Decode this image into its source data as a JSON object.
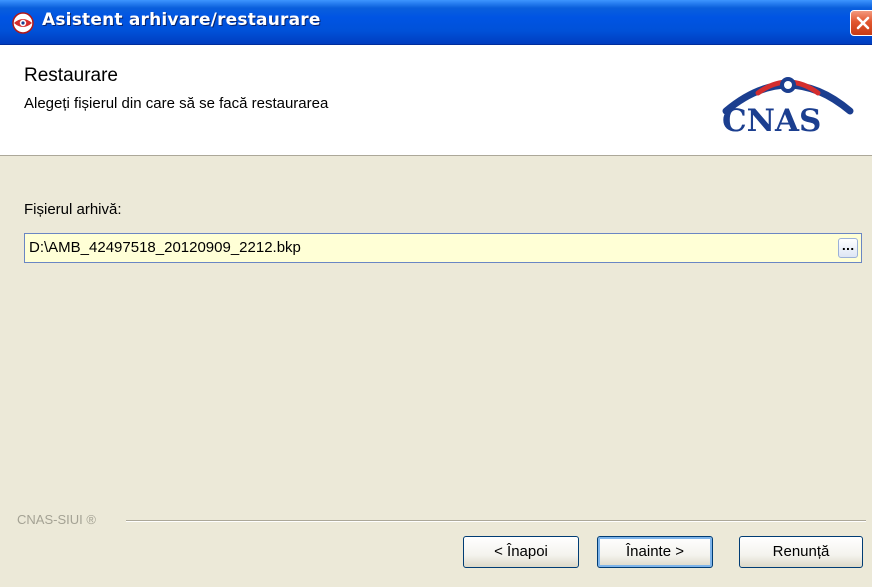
{
  "window": {
    "title": "Asistent arhivare/restaurare"
  },
  "header": {
    "title": "Restaurare",
    "subtitle": "Alegeți fișierul din care să se facă restaurarea",
    "logo_text": "CNAS"
  },
  "form": {
    "file_label": "Fișierul arhivă:",
    "file_value": "D:\\AMB_42497518_20120909_2212.bkp",
    "browse_label": "..."
  },
  "footer": {
    "brand": "CNAS-SIUI ®",
    "back_label": "< Înapoi",
    "next_label": "Înainte >",
    "cancel_label": "Renunță"
  },
  "colors": {
    "titlebar": "#0054e3",
    "dialog_bg": "#ece9d8",
    "field_bg": "#ffffd6",
    "logo_blue": "#1b3e8f",
    "logo_red": "#d42d2d"
  },
  "icons": {
    "title": "eye-app-icon",
    "close": "close-icon",
    "logo": "cnas-logo"
  }
}
